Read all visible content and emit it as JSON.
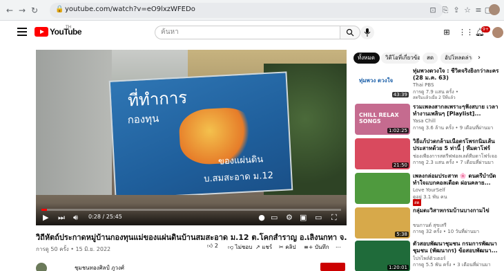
{
  "browser": {
    "url": "youtube.com/watch?v=eO9lxzWFEDo"
  },
  "header": {
    "logo_text": "YouTube",
    "logo_sup": "TH",
    "search_placeholder": "ค้นหา",
    "notification_count": "9+"
  },
  "player": {
    "time": "0:28 / 25:45",
    "progress_fraction": 0.018,
    "sign": {
      "line1": "ที่ทำการ",
      "line2": "กองทุน",
      "line3": "ของแผ่นดิน",
      "line4": "บ.สมสะอาด ม.12"
    }
  },
  "video": {
    "title": "วิถีหัตถ์ประกาดหมู่บ้านกองทุนแม่ของแผ่นดินบ้านสมสะอาด ม.12 ต.โคกสำราญ อ.เลิงนกทา จ.ยโสธร",
    "meta": "การดู 50 ครั้ง • 15 มิ.ย. 2022",
    "like_count": "2",
    "dislike_label": "ไม่ชอบ",
    "share_label": "แชร์",
    "clip_label": "คลิป",
    "save_label": "บันทึก",
    "more_label": "...",
    "channel_name": "ชุมชนทองศิลป์ ภูวงศ์"
  },
  "chips": [
    {
      "label": "ทั้งหมด",
      "active": true
    },
    {
      "label": "วิดีโอที่เกี่ยวข้อง",
      "active": false
    },
    {
      "label": "สด",
      "active": false
    },
    {
      "label": "อัปโหลดล่าสุด",
      "active": false
    }
  ],
  "recommendations": [
    {
      "title": "ทุ่มพวงดวงใจ : ชีวิตจริงยิ่งกว่าละคร (28 ม.ค. 63)",
      "channel": "Thai PBS",
      "meta": "การดู 7.9 แสน ครั้ง •",
      "meta2": "สตรีมแล้วเมื่อ 2 ปีที่แล้ว",
      "duration": "43:39",
      "thumb_caption": "ทุ่มพวง ดวงใจ",
      "thumb_color": "#ffffff"
    },
    {
      "title": "รวมเพลงสากลเพราะๆฟังสบาย เวลาทำงานเพลินๆ [Playlist]...",
      "channel": "Yasa Chill",
      "meta": "การดู 3.6 ล้าน ครั้ง • 9 เดือนที่ผ่านมา",
      "meta2": "",
      "duration": "1:02:25",
      "thumb_caption": "CHILL RELAX SONGS",
      "thumb_color": "#c56b8f"
    },
    {
      "title": "วิธีแก้ปวดกล้ามเนื้อตรโพรกนิ่มเส้นประสาทด้วย 5 ท่านี้ | ทีมดาโฟร์เจอ...",
      "channel": "ช่องเพียงการสตรีฟฟอลเลต์ทีมดาโฟร์เจอ",
      "meta": "การดู 2.3 แสน ครั้ง • 7 เดือนที่ผ่านมา",
      "meta2": "",
      "duration": "21:50",
      "thumb_caption": "",
      "thumb_color": "#d94a5e"
    },
    {
      "title": "เพลงกล่อมประสาท 🌸 ดนตรีบำบัด ทำใจแบกคอลเดือด ผ่อนคลาย...",
      "channel": "Love YourSelf",
      "meta": "ดูอยู่ 3.1 พัน คน",
      "meta2": "",
      "duration": "",
      "thumb_caption": "",
      "thumb_color": "#4f9a3e",
      "badge": "สด"
    },
    {
      "title": "กลุ่มตะวิสาหกรมบ้านบางกามไข่",
      "channel": "ขนกานต์ สุขเสรี",
      "meta": "การดู 32 ครั้ง • 10 วันที่ผ่านมา",
      "meta2": "",
      "duration": "5:38",
      "thumb_caption": "",
      "thumb_color": "#d7a94a"
    },
    {
      "title": "ตัวสอบพัฒนาชุมชน กรมการพัฒนาชุมชน (พัฒนากร) ข้อสอบพัฒนา...",
      "channel": "ไปรไพล์ติวเตอร์",
      "meta": "การดู 5.5 พัน ครั้ง • 3 เดือนที่ผ่านมา",
      "meta2": "",
      "duration": "1:20:01",
      "thumb_caption": "",
      "thumb_color": "#1f6b3a"
    }
  ]
}
